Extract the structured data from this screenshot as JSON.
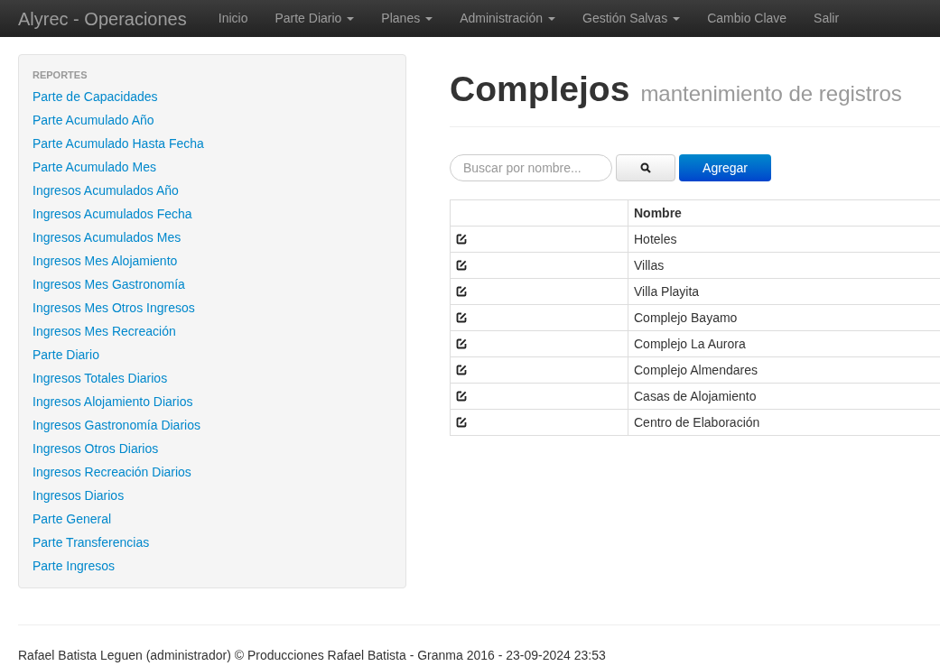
{
  "navbar": {
    "brand": "Alyrec - Operaciones",
    "items": [
      {
        "label": "Inicio",
        "kind": "link"
      },
      {
        "label": "Parte Diario",
        "kind": "dropdown"
      },
      {
        "label": "Planes",
        "kind": "dropdown"
      },
      {
        "label": "Administración",
        "kind": "dropdown"
      },
      {
        "label": "Gestión Salvas",
        "kind": "dropdown"
      },
      {
        "label": "Cambio Clave",
        "kind": "link"
      },
      {
        "label": "Salir",
        "kind": "link"
      }
    ]
  },
  "sidebar": {
    "header": "REPORTES",
    "items": [
      "Parte de Capacidades",
      "Parte Acumulado Año",
      "Parte Acumulado Hasta Fecha",
      "Parte Acumulado Mes",
      "Ingresos Acumulados Año",
      "Ingresos Acumulados Fecha",
      "Ingresos Acumulados Mes",
      "Ingresos Mes Alojamiento",
      "Ingresos Mes Gastronomía",
      "Ingresos Mes Otros Ingresos",
      "Ingresos Mes Recreación",
      "Parte Diario",
      "Ingresos Totales Diarios",
      "Ingresos Alojamiento Diarios",
      "Ingresos Gastronomía Diarios",
      "Ingresos Otros Diarios",
      "Ingresos Recreación Diarios",
      "Ingresos Diarios",
      "Parte General",
      "Parte Transferencias",
      "Parte Ingresos"
    ]
  },
  "page": {
    "title": "Complejos",
    "subtitle": "mantenimiento de registros"
  },
  "search": {
    "placeholder": "Buscar por nombre..."
  },
  "add_button": "Agregar",
  "table": {
    "columns": [
      "Nombre"
    ],
    "rows": [
      "Hoteles",
      "Villas",
      "Villa Playita",
      "Complejo Bayamo",
      "Complejo La Aurora",
      "Complejo Almendares",
      "Casas de Alojamiento",
      "Centro de Elaboración"
    ]
  },
  "footer": "Rafael Batista Leguen (administrador) © Producciones Rafael Batista - Granma 2016 - 23-09-2024 23:53"
}
